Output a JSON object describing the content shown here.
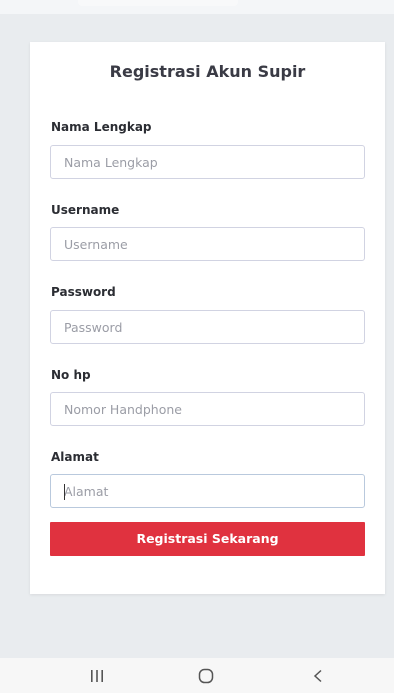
{
  "form": {
    "title": "Registrasi Akun Supir",
    "fields": [
      {
        "label": "Nama Lengkap",
        "placeholder": "Nama Lengkap",
        "value": ""
      },
      {
        "label": "Username",
        "placeholder": "Username",
        "value": ""
      },
      {
        "label": "Password",
        "placeholder": "Password",
        "value": ""
      },
      {
        "label": "No hp",
        "placeholder": "Nomor Handphone",
        "value": ""
      },
      {
        "label": "Alamat",
        "placeholder": "Alamat",
        "value": ""
      }
    ],
    "submit_label": "Registrasi Sekarang"
  },
  "colors": {
    "primary_button": "#e0323f",
    "background": "#e9ecef",
    "card": "#ffffff"
  },
  "navbar": {
    "icons": [
      "recent-apps-icon",
      "home-icon",
      "back-icon"
    ]
  }
}
